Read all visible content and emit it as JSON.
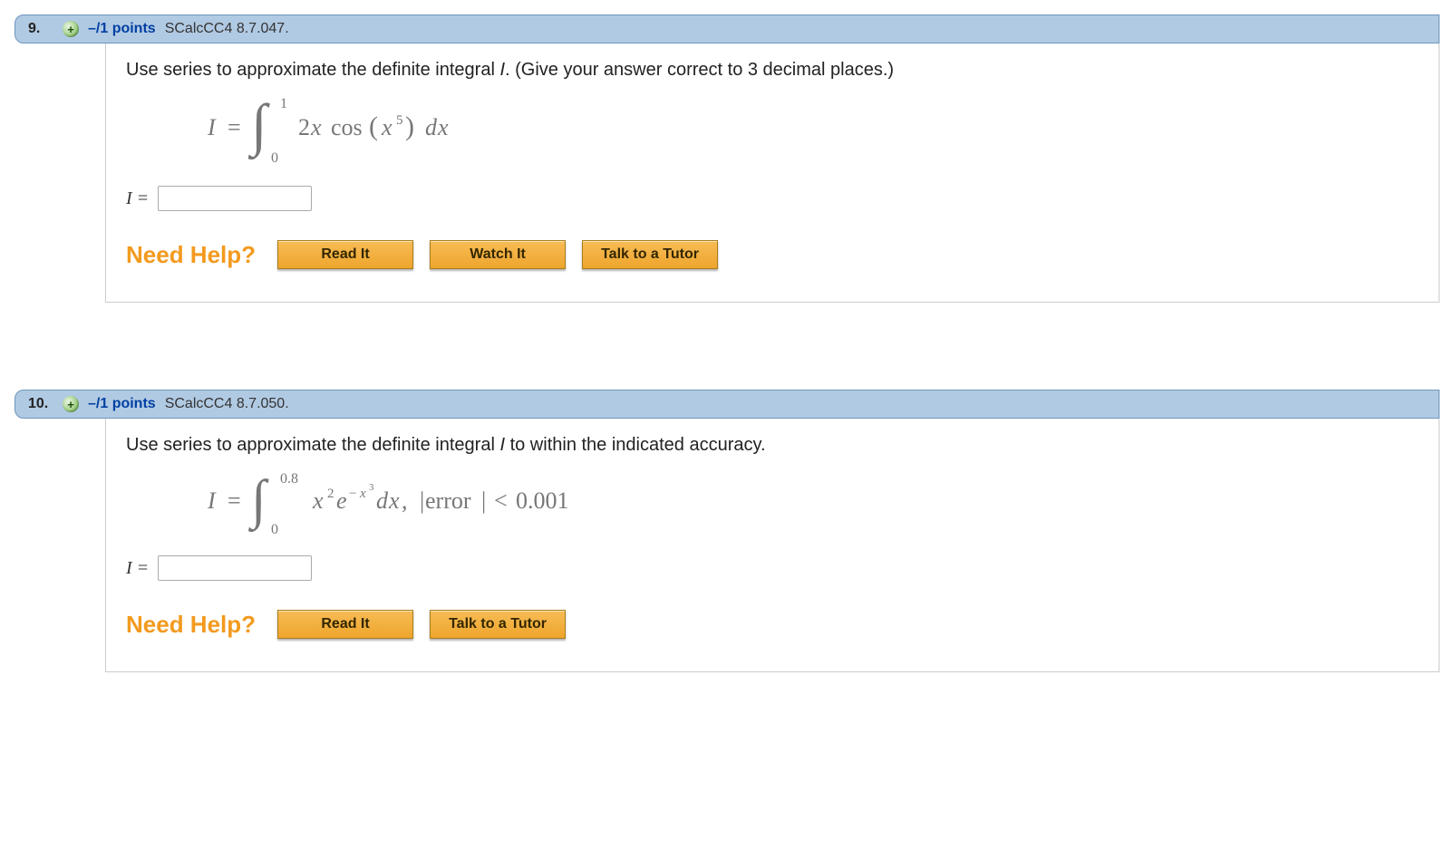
{
  "questions": [
    {
      "number": "9.",
      "points": "–/1 points",
      "ref": "SCalcCC4 8.7.047.",
      "prompt_html": "Use series to approximate the definite integral <em>I</em>. (Give your answer correct to 3 decimal places.)",
      "answer_label": "I =",
      "needHelp": "Need Help?",
      "helpButtons": [
        "Read It",
        "Watch It",
        "Talk to a Tutor"
      ]
    },
    {
      "number": "10.",
      "points": "–/1 points",
      "ref": "SCalcCC4 8.7.050.",
      "prompt_html": "Use series to approximate the definite integral <em>I</em> to within the indicated accuracy.",
      "answer_label": "I =",
      "needHelp": "Need Help?",
      "helpButtons": [
        "Read It",
        "Talk to a Tutor"
      ]
    }
  ],
  "equations": {
    "q9_tex": "I = \\int_0^1 2x \\cos(x^5)\\,dx",
    "q10_tex": "I = \\int_0^{0.8} x^2 e^{-x^3}\\,dx,\\; |\\text{error}| < 0.001"
  }
}
